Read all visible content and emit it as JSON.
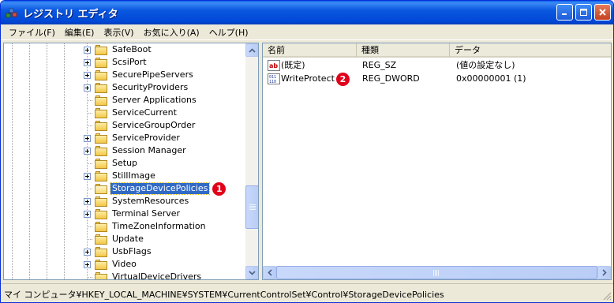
{
  "window": {
    "title": "レジストリ エディタ"
  },
  "menu": [
    "ファイル(F)",
    "編集(E)",
    "表示(V)",
    "お気に入り(A)",
    "ヘルプ(H)"
  ],
  "tree": {
    "items": [
      {
        "label": "SafeBoot",
        "expandable": true
      },
      {
        "label": "ScsiPort",
        "expandable": true
      },
      {
        "label": "SecurePipeServers",
        "expandable": true
      },
      {
        "label": "SecurityProviders",
        "expandable": true
      },
      {
        "label": "Server Applications",
        "expandable": false
      },
      {
        "label": "ServiceCurrent",
        "expandable": false
      },
      {
        "label": "ServiceGroupOrder",
        "expandable": false
      },
      {
        "label": "ServiceProvider",
        "expandable": true
      },
      {
        "label": "Session Manager",
        "expandable": true
      },
      {
        "label": "Setup",
        "expandable": false
      },
      {
        "label": "StillImage",
        "expandable": true
      },
      {
        "label": "StorageDevicePolicies",
        "expandable": false,
        "selected": true,
        "badge": "1"
      },
      {
        "label": "SystemResources",
        "expandable": true
      },
      {
        "label": "Terminal Server",
        "expandable": true
      },
      {
        "label": "TimeZoneInformation",
        "expandable": false
      },
      {
        "label": "Update",
        "expandable": false
      },
      {
        "label": "UsbFlags",
        "expandable": true
      },
      {
        "label": "Video",
        "expandable": true
      },
      {
        "label": "VirtualDeviceDrivers",
        "expandable": false
      }
    ]
  },
  "list": {
    "columns": [
      "名前",
      "種類",
      "データ"
    ],
    "rows": [
      {
        "icon": "string-value-icon",
        "name": "(既定)",
        "type": "REG_SZ",
        "data": "(値の設定なし)",
        "badge": ""
      },
      {
        "icon": "binary-value-icon",
        "name": "WriteProtect",
        "type": "REG_DWORD",
        "data": "0x00000001 (1)",
        "badge": "2"
      }
    ]
  },
  "status": {
    "path": "マイ コンピュータ¥HKEY_LOCAL_MACHINE¥SYSTEM¥CurrentControlSet¥Control¥StorageDevicePolicies"
  },
  "colors": {
    "selection": "#316AC5",
    "badge": "#E0001A",
    "titlebar": "#0A58E0"
  }
}
